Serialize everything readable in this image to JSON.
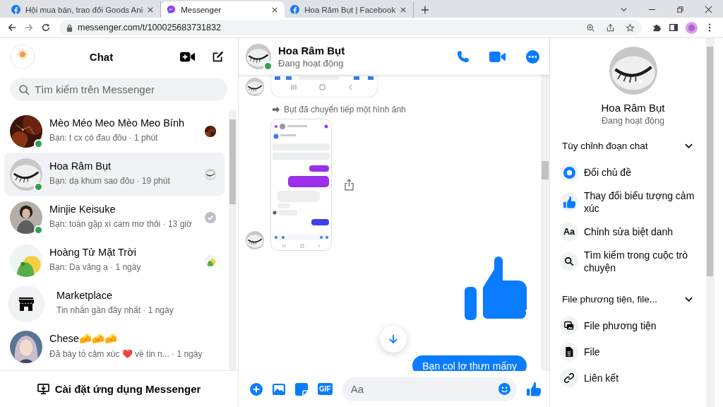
{
  "browser": {
    "tabs": [
      {
        "title": "Hội mua bán, trao đổi Goods Ani",
        "kind": "facebook",
        "selected": false
      },
      {
        "title": "Messenger",
        "kind": "messenger",
        "selected": true
      },
      {
        "title": "Hoa Râm Bụt | Facebook",
        "kind": "facebook",
        "selected": false
      }
    ],
    "url": "messenger.com/t/100025683731832"
  },
  "sidebar": {
    "title": "Chat",
    "search": {
      "placeholder": "Tìm kiếm trên Messenger"
    },
    "conversations": [
      {
        "kind": "person",
        "name": "Mèo Méo Meo Mèo Meo Bính",
        "preview": "Bạn: t cx có đau đôu · 1 phút",
        "online": true,
        "selected": false,
        "seen": true,
        "delivered": false
      },
      {
        "kind": "person",
        "name": "Hoa Râm Bụt",
        "preview": "Bạn: dạ khum sao đôu · 19 phút",
        "online": true,
        "selected": true,
        "seen": true,
        "delivered": false
      },
      {
        "kind": "person",
        "name": "Minjie Keisuke",
        "preview": "Bạn: toàn gặp xì cam mơ thôi · 13 giờ",
        "online": true,
        "selected": false,
        "seen": false,
        "delivered": true
      },
      {
        "kind": "person",
        "name": "Hoàng Tử Mặt Trời",
        "preview": "Bạn: Dạ vâng ạ · 1 ngày",
        "online": false,
        "selected": false,
        "seen": true,
        "delivered": false
      },
      {
        "kind": "marketplace",
        "name": "Marketplace",
        "preview": "Tin nhắn gần đây nhất · 1 ngày",
        "online": false,
        "selected": false,
        "seen": false,
        "delivered": false
      },
      {
        "kind": "person",
        "name": "Chese🧀🧀🧀",
        "preview": "Đã bày tỏ cảm xúc ❤️ về tin n... · 1 ngày",
        "online": false,
        "selected": false,
        "seen": false,
        "delivered": false
      }
    ],
    "install": "Cài đặt ứng dụng Messenger"
  },
  "chat": {
    "name": "Hoa Râm Bụt",
    "status": "Đang hoạt động",
    "online": true,
    "messages": [
      {
        "kind": "screenshot_tail"
      },
      {
        "kind": "forward_note",
        "text": "Bụt đã chuyển tiếp một hình ảnh"
      },
      {
        "kind": "screenshot"
      },
      {
        "kind": "like"
      },
      {
        "kind": "text",
        "text": "Bạn col lơ thưn mấny"
      }
    ],
    "composer": {
      "placeholder": "Aa",
      "gif_label": "GIF"
    }
  },
  "info": {
    "name": "Hoa Râm Bụt",
    "status": "Đang hoạt động",
    "sections": [
      {
        "title": "Tùy chỉnh đoạn chat",
        "expanded": true,
        "items": [
          {
            "label": "Đổi chủ đề",
            "kind": "theme"
          },
          {
            "label": "Thay đổi biểu tượng cảm xúc",
            "kind": "emoji"
          },
          {
            "label": "Chỉnh sửa biệt danh",
            "kind": "nickname",
            "icon_text": "Aa"
          },
          {
            "label": "Tìm kiếm trong cuộc trò chuyện",
            "kind": "search"
          }
        ]
      },
      {
        "title": "File phương tiện, file...",
        "expanded": true,
        "items": [
          {
            "label": "File phương tiện",
            "kind": "media"
          },
          {
            "label": "File",
            "kind": "file"
          },
          {
            "label": "Liên kết",
            "kind": "link"
          }
        ]
      }
    ]
  }
}
